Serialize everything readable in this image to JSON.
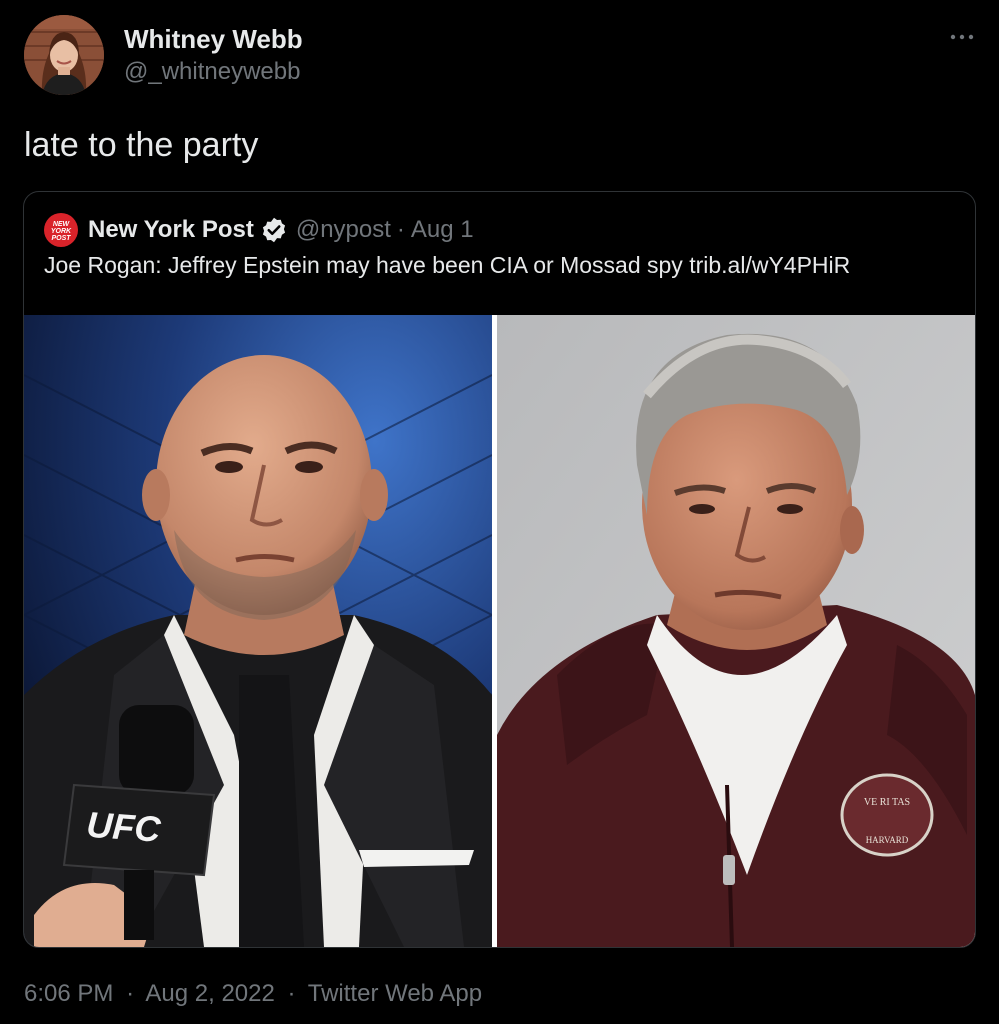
{
  "tweet": {
    "author": {
      "name": "Whitney Webb",
      "handle": "@_whitneywebb"
    },
    "text": "late to the party",
    "time": "6:06 PM",
    "date": "Aug 2, 2022",
    "source": "Twitter Web App",
    "separator": "·",
    "more_icon": "more-horizontal-icon"
  },
  "quoted": {
    "name": "New York Post",
    "verified": true,
    "handle": "@nypost",
    "separator": "·",
    "date": "Aug 1",
    "text": "Joe Rogan: Jeffrey Epstein may have been CIA or Mossad spy trib.al/wY4PHiR",
    "logo_text": "NEW YORK POST",
    "media": {
      "left_photo": {
        "mic_label": "UFC"
      },
      "right_photo": {
        "emblem_text": "VE RI TAS",
        "emblem_ring": "HARVARD"
      }
    }
  },
  "colors": {
    "background": "#000000",
    "text_primary": "#e7e9ea",
    "text_secondary": "#71767b",
    "border": "#2f3336",
    "verified_blue": "#1d9bf0",
    "nypost_red": "#d9232a"
  }
}
